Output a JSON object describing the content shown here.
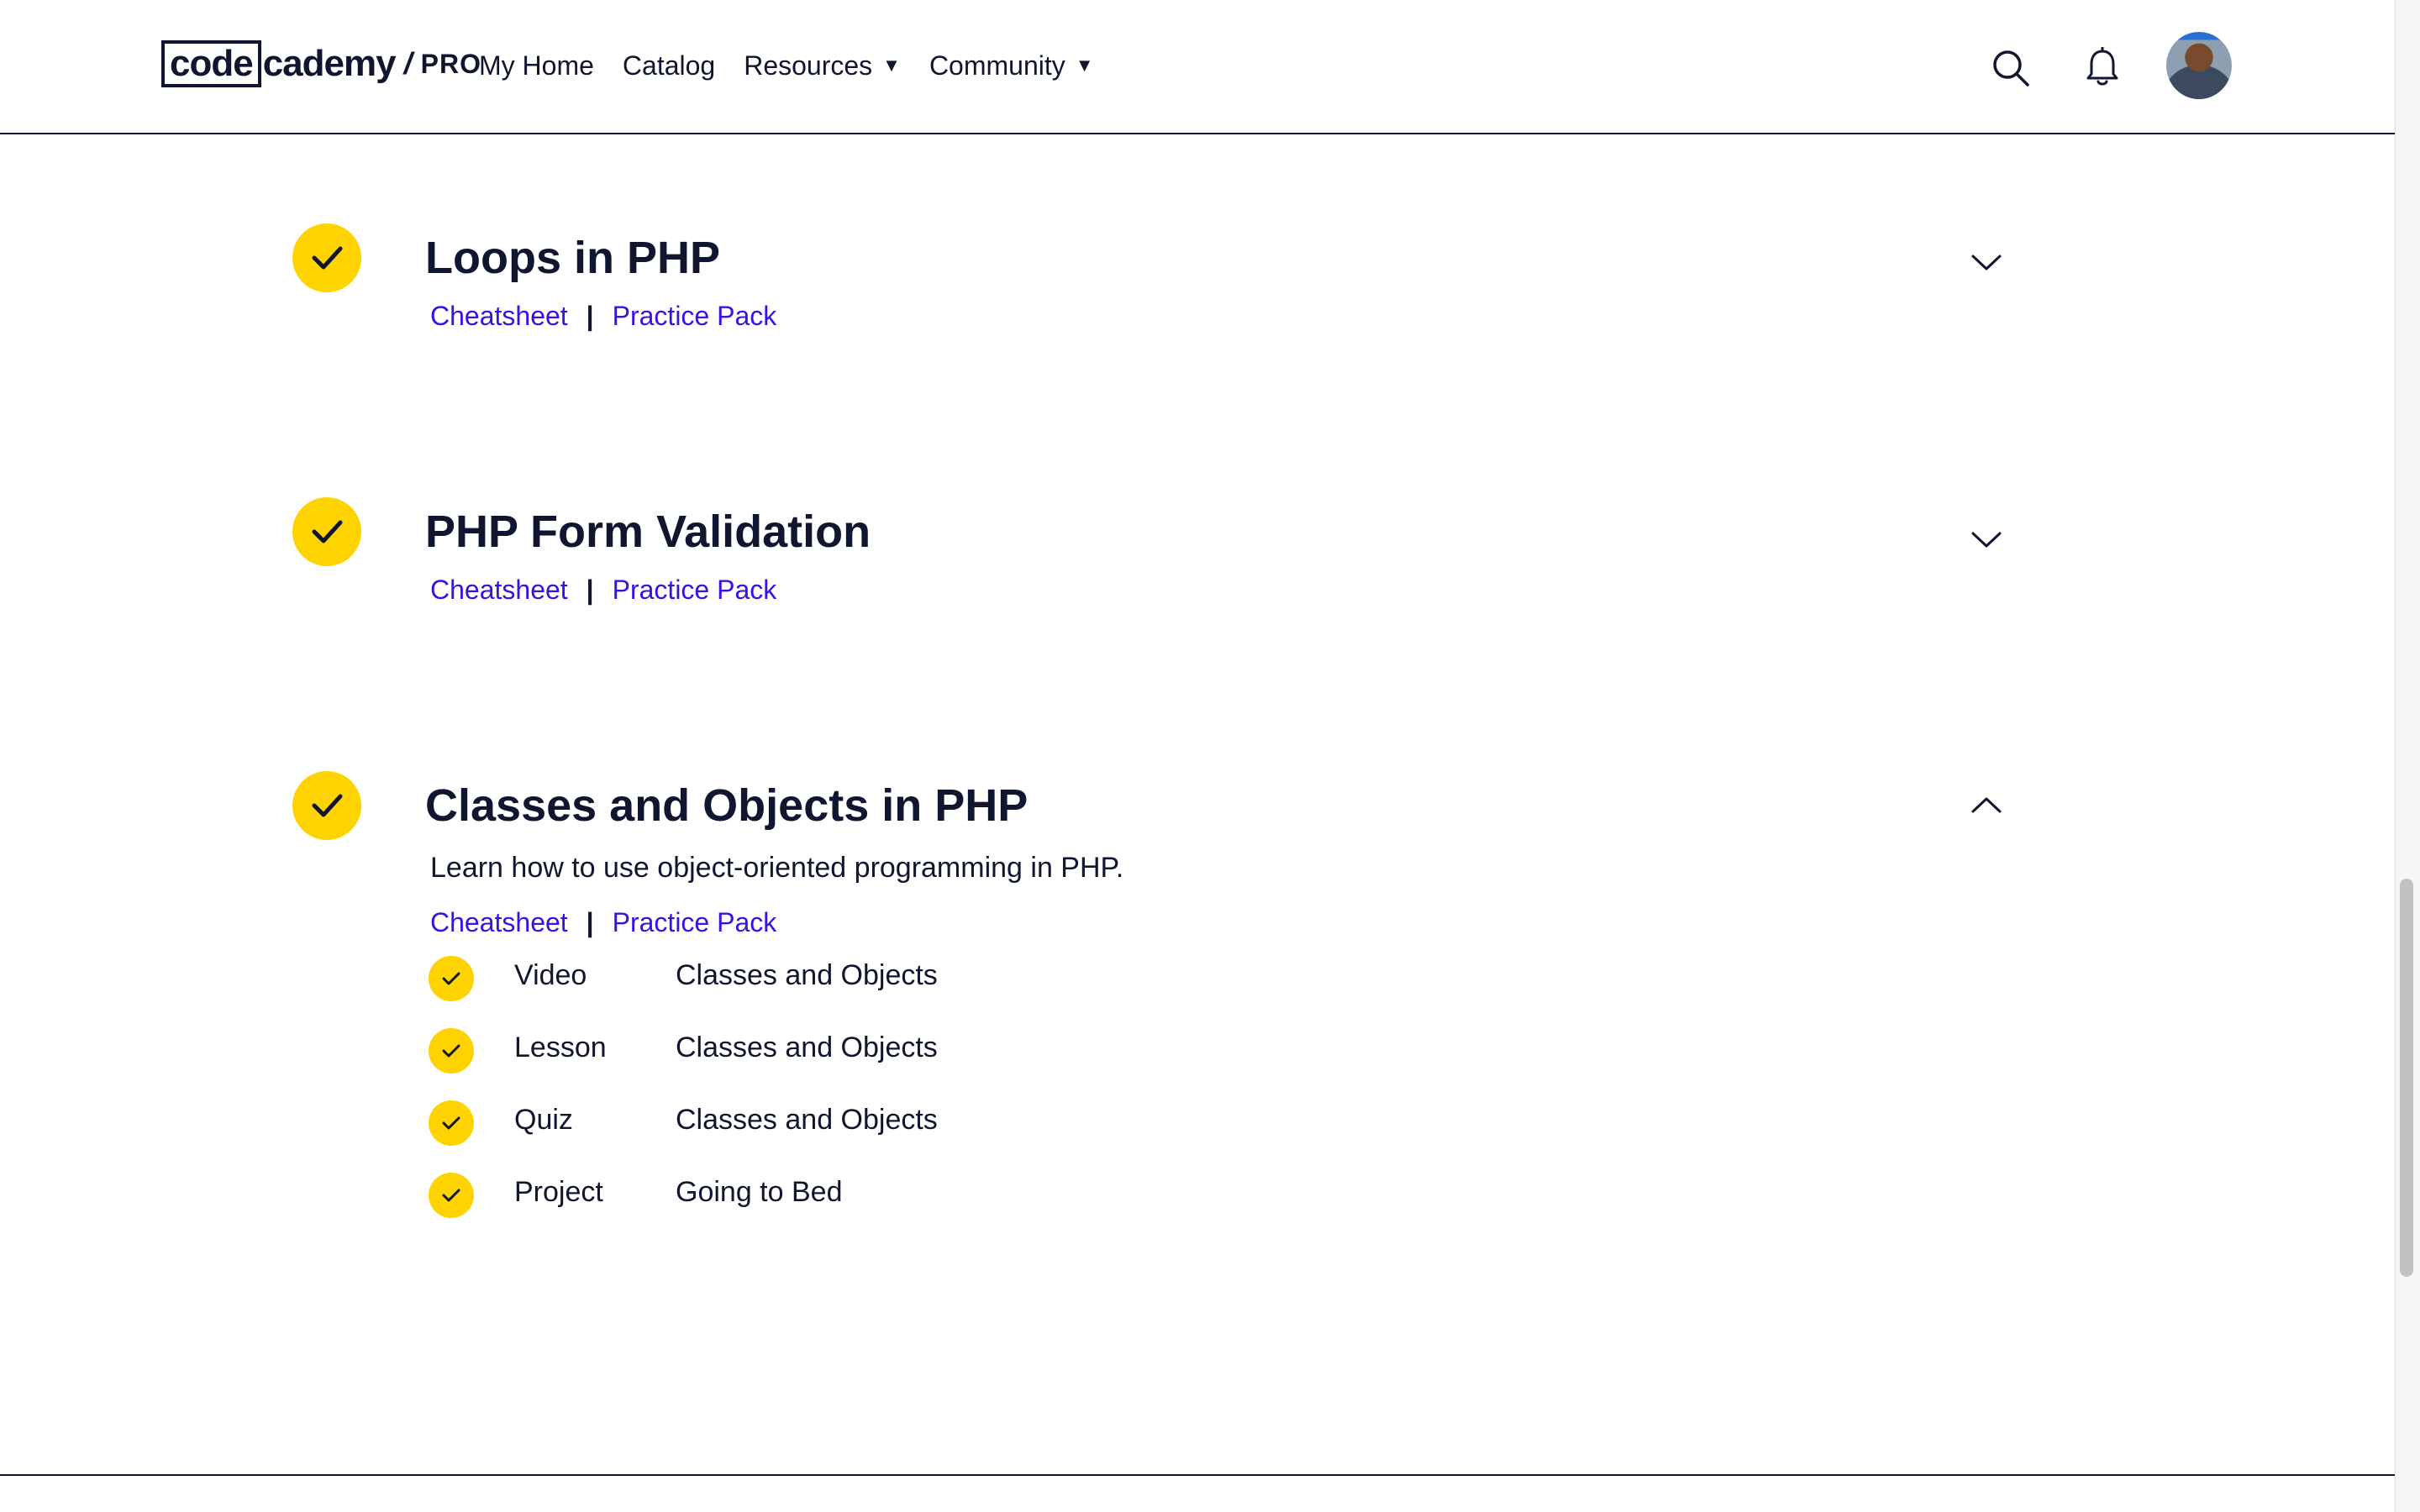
{
  "header": {
    "logo": {
      "code": "code",
      "cademy": "cademy",
      "slash": "/",
      "pro": "PRO"
    },
    "nav": [
      {
        "label": "My Home",
        "has_caret": false
      },
      {
        "label": "Catalog",
        "has_caret": false
      },
      {
        "label": "Resources",
        "has_caret": true
      },
      {
        "label": "Community",
        "has_caret": true
      }
    ],
    "caret_glyph": "▼",
    "icons": [
      "search-icon",
      "bell-icon",
      "avatar"
    ]
  },
  "modules": [
    {
      "title": "Loops in PHP",
      "expanded": false,
      "completed": true,
      "links": {
        "cheatsheet": "Cheatsheet",
        "separator": "|",
        "practice": "Practice Pack"
      }
    },
    {
      "title": "PHP Form Validation",
      "expanded": false,
      "completed": true,
      "links": {
        "cheatsheet": "Cheatsheet",
        "separator": "|",
        "practice": "Practice Pack"
      }
    },
    {
      "title": "Classes and Objects in PHP",
      "expanded": true,
      "completed": true,
      "description": "Learn how to use object-oriented programming in PHP.",
      "links": {
        "cheatsheet": "Cheatsheet",
        "separator": "|",
        "practice": "Practice Pack"
      },
      "items": [
        {
          "type": "Video",
          "name": "Classes and Objects",
          "completed": true
        },
        {
          "type": "Lesson",
          "name": "Classes and Objects",
          "completed": true
        },
        {
          "type": "Quiz",
          "name": "Classes and Objects",
          "completed": true
        },
        {
          "type": "Project",
          "name": "Going to Bed",
          "completed": true
        }
      ]
    }
  ],
  "colors": {
    "navy": "#10162f",
    "check_yellow": "#ffd300",
    "link_purple": "#3a10e5"
  }
}
